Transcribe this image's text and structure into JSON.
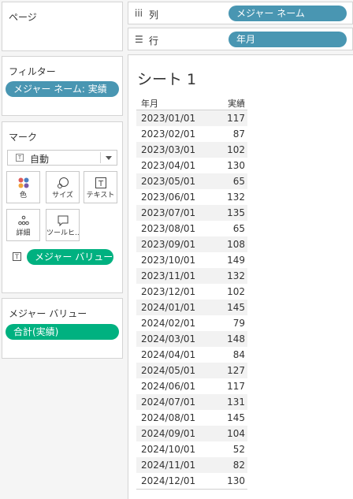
{
  "left": {
    "pages_title": "ページ",
    "filters_title": "フィルター",
    "filter_pill": "メジャー ネーム: 実績",
    "marks_title": "マーク",
    "mark_type": "自動",
    "buttons": {
      "color": "色",
      "size": "サイズ",
      "text": "テキスト",
      "detail": "詳細",
      "tooltip": "ツールヒ..."
    },
    "text_pill": "メジャー バリュー",
    "mv_title": "メジャー バリュー",
    "mv_pill": "合計(実績)"
  },
  "shelves": {
    "columns_label": "列",
    "columns_pill": "メジャー ネーム",
    "rows_label": "行",
    "rows_pill": "年月"
  },
  "sheet": {
    "title": "シート 1",
    "col_headers": [
      "年月",
      "実績"
    ],
    "rows": [
      [
        "2023/01/01",
        "117"
      ],
      [
        "2023/02/01",
        "87"
      ],
      [
        "2023/03/01",
        "102"
      ],
      [
        "2023/04/01",
        "130"
      ],
      [
        "2023/05/01",
        "65"
      ],
      [
        "2023/06/01",
        "132"
      ],
      [
        "2023/07/01",
        "135"
      ],
      [
        "2023/08/01",
        "65"
      ],
      [
        "2023/09/01",
        "108"
      ],
      [
        "2023/10/01",
        "149"
      ],
      [
        "2023/11/01",
        "132"
      ],
      [
        "2023/12/01",
        "102"
      ],
      [
        "2024/01/01",
        "145"
      ],
      [
        "2024/02/01",
        "79"
      ],
      [
        "2024/03/01",
        "148"
      ],
      [
        "2024/04/01",
        "84"
      ],
      [
        "2024/05/01",
        "127"
      ],
      [
        "2024/06/01",
        "117"
      ],
      [
        "2024/07/01",
        "131"
      ],
      [
        "2024/08/01",
        "145"
      ],
      [
        "2024/09/01",
        "104"
      ],
      [
        "2024/10/01",
        "52"
      ],
      [
        "2024/11/01",
        "82"
      ],
      [
        "2024/12/01",
        "130"
      ]
    ]
  },
  "icons": {
    "columns": "columns-icon",
    "rows": "rows-icon",
    "color": "color-icon",
    "size": "size-icon",
    "text": "text-icon",
    "detail": "detail-icon",
    "tooltip": "tooltip-icon"
  }
}
